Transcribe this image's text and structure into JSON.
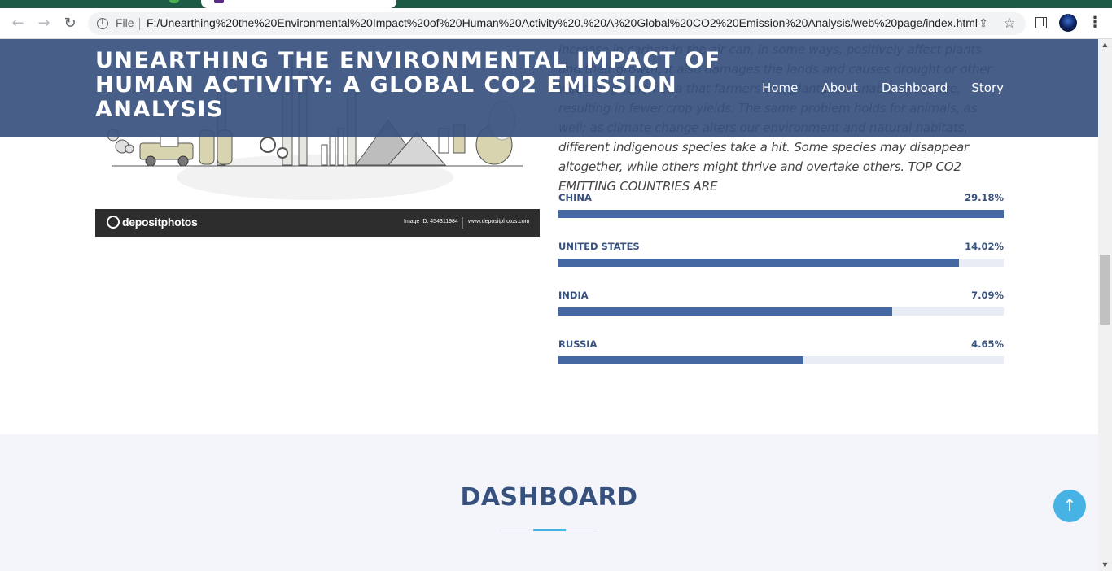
{
  "browser": {
    "file_label": "File",
    "url": "F:/Unearthing%20the%20Environmental%20Impact%20of%20Human%20Activity%20.%20A%20Global%20CO2%20Emission%20Analysis/web%20page/index.html",
    "icons": {
      "back": "arrow-left-icon",
      "forward": "arrow-right-icon",
      "reload": "reload-icon",
      "info": "info-icon",
      "share": "share-icon",
      "bookmark": "star-icon",
      "side_panel": "side-panel-icon",
      "profile": "avatar",
      "menu": "kebab-menu-icon"
    },
    "colors": {
      "tabstrip": "#1e5b47"
    }
  },
  "header": {
    "title": "UNEARTHING THE ENVIRONMENTAL IMPACT OF HUMAN ACTIVITY: A GLOBAL CO2 EMISSION ANALYSIS",
    "nav": [
      "Home",
      "About",
      "Dashboard",
      "Story"
    ],
    "background": "#37517e"
  },
  "about": {
    "paragraph": "increase in carbon in the air can, in some ways, positively affect plants and their growth, it also damages the lands and causes drought or other weather phenomena that farmers and plants are unable to survive, resulting in fewer crop yields. The same problem holds for animals, as well; as climate change alters our environment and natural habitats, different indigenous species take a hit. Some species may disappear altogether, while others might thrive and overtake others. TOP CO2 EMITTING COUNTRIES ARE",
    "image_watermark": {
      "brand": "depositphotos",
      "image_id": "Image ID: 454311984",
      "site": "www.depositphotos.com"
    },
    "countries": [
      {
        "name": "CHINA",
        "value": "29.18%",
        "fill": 1.0
      },
      {
        "name": "UNITED STATES",
        "value": "14.02%",
        "fill": 0.9
      },
      {
        "name": "INDIA",
        "value": "7.09%",
        "fill": 0.75
      },
      {
        "name": "RUSSIA",
        "value": "4.65%",
        "fill": 0.55
      }
    ],
    "bar_color": "#4668a2"
  },
  "dashboard": {
    "title": "DASHBOARD",
    "accent": "#47b2e4"
  },
  "back_to_top": {
    "icon": "arrow-up-icon",
    "glyph": "↑"
  }
}
